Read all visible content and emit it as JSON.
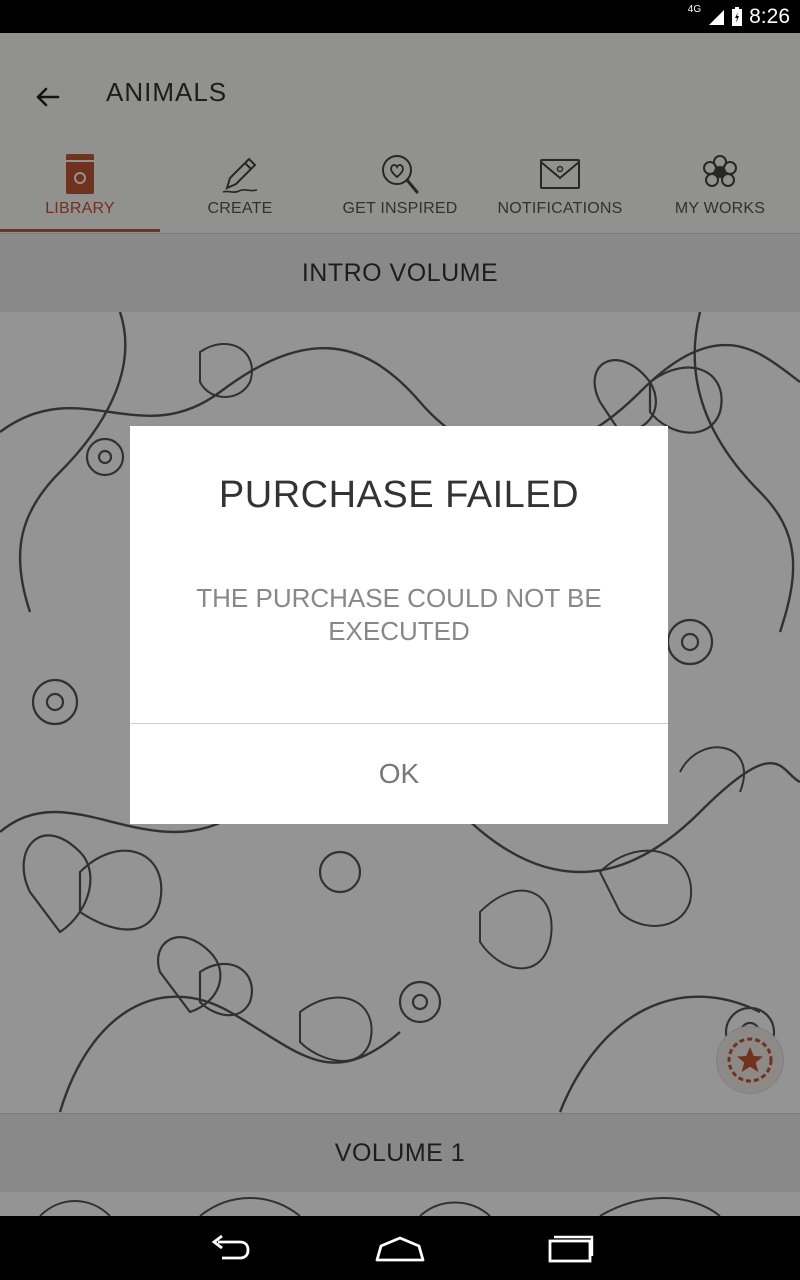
{
  "status_bar": {
    "network": "4G",
    "time": "8:26"
  },
  "toolbar": {
    "title": "ANIMALS",
    "back_icon": "arrow-left-icon"
  },
  "tabs": [
    {
      "label": "LIBRARY",
      "icon": "book-icon",
      "active": true
    },
    {
      "label": "CREATE",
      "icon": "pencil-icon",
      "active": false
    },
    {
      "label": "GET INSPIRED",
      "icon": "magnifier-heart-icon",
      "active": false
    },
    {
      "label": "NOTIFICATIONS",
      "icon": "envelope-icon",
      "active": false
    },
    {
      "label": "MY WORKS",
      "icon": "flower-icon",
      "active": false
    }
  ],
  "sections": [
    {
      "label": "INTRO VOLUME"
    },
    {
      "label": "VOLUME 1"
    }
  ],
  "dialog": {
    "title": "PURCHASE FAILED",
    "message": "THE PURCHASE COULD NOT BE EXECUTED",
    "ok_label": "OK"
  },
  "fab": {
    "icon": "star-badge-icon"
  },
  "nav_bar": {
    "icons": [
      "back-icon",
      "home-icon",
      "recents-icon"
    ]
  },
  "colors": {
    "accent": "#c25536"
  }
}
